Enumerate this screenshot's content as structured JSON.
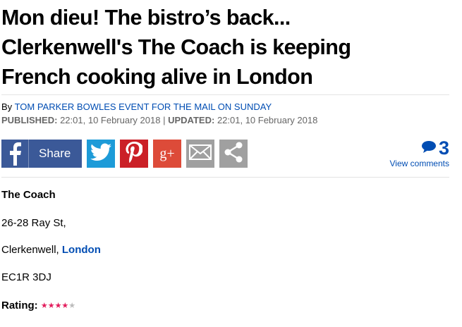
{
  "article": {
    "headline_line1": "Mon dieu! The bistro’s back...",
    "headline_line2": "Clerkenwell's The Coach is keeping",
    "headline_line3": "French cooking alive in London",
    "byline_prefix": "By",
    "author": "TOM PARKER BOWLES EVENT FOR THE MAIL ON SUNDAY",
    "published_label": "PUBLISHED:",
    "published_value": "22:01, 10 February 2018",
    "separator": "|",
    "updated_label": "UPDATED:",
    "updated_value": "22:01, 10 February 2018"
  },
  "share": {
    "facebook_label": "Share",
    "icons": [
      "facebook-icon",
      "twitter-icon",
      "pinterest-icon",
      "google-plus-icon",
      "email-icon",
      "share-icon"
    ],
    "colors": {
      "facebook": "#3b5998",
      "twitter": "#1d9bd8",
      "pinterest": "#cb2027",
      "googleplus": "#dd4b39",
      "email": "#a0a0a0",
      "share": "#a0a0a0"
    },
    "googleplus_glyph": "g+"
  },
  "comments": {
    "count": "3",
    "label": "View comments"
  },
  "review": {
    "name": "The Coach",
    "address_line1": "26-28 Ray St,",
    "address_line2_prefix": "Clerkenwell,",
    "address_line2_link": "London",
    "postcode": "EC1R 3DJ",
    "rating_label": "Rating:",
    "rating_stars_on": "★★★★",
    "rating_stars_off": "★",
    "rating_value": 4,
    "rating_max": 5
  },
  "colors": {
    "link": "#004db3",
    "star": "#e31c5c"
  }
}
